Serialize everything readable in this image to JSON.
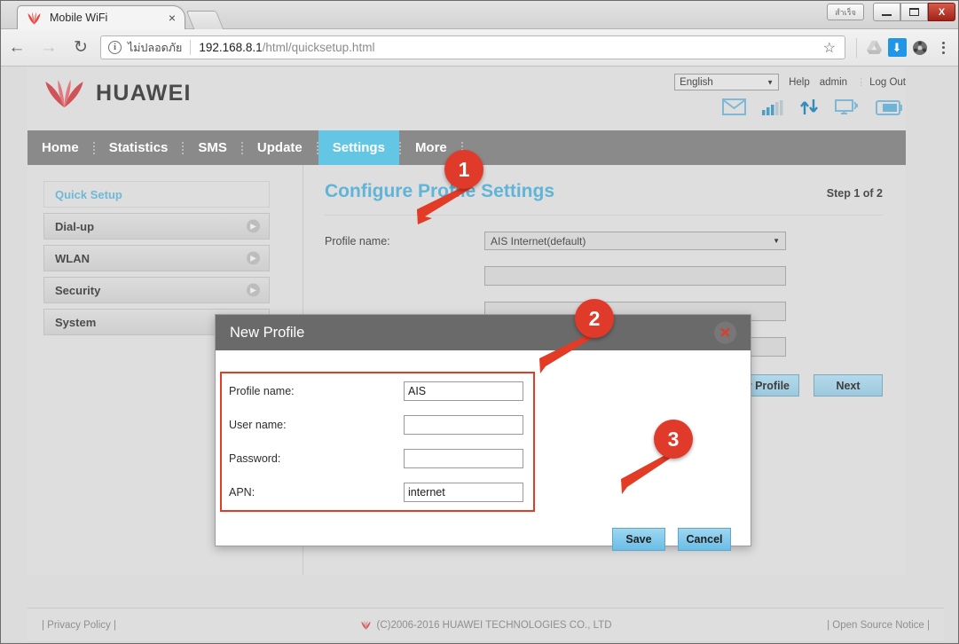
{
  "browser": {
    "tab": {
      "title": "Mobile WiFi",
      "close_label": "×",
      "favicon": "huawei-petal-icon"
    },
    "newtab_label": "",
    "window_controls": {
      "thai_button": "สำเร็จ",
      "minimize": "minimize-icon",
      "maximize": "maximize-icon",
      "close": "X"
    },
    "toolbar": {
      "back": "←",
      "forward": "→",
      "reload": "↻",
      "security_label": "ไม่ปลอดภัย",
      "url_host": "192.168.8.1",
      "url_path": "/html/quicksetup.html",
      "bookmark": "☆",
      "extensions": [
        "drive-icon",
        "download-icon",
        "film-reel-icon"
      ],
      "menu": "kebab-menu-icon"
    }
  },
  "header": {
    "language": {
      "value": "English",
      "caret": "▼"
    },
    "links": [
      "Help",
      "admin",
      "Log Out"
    ],
    "logo_text": "HUAWEI",
    "status_icons": [
      "envelope-icon",
      "signal-bars-icon",
      "data-transfer-icon",
      "wifi-monitor-icon",
      "battery-icon"
    ]
  },
  "nav": {
    "items": [
      {
        "label": "Home",
        "active": false
      },
      {
        "label": "Statistics",
        "active": false
      },
      {
        "label": "SMS",
        "active": false
      },
      {
        "label": "Update",
        "active": false
      },
      {
        "label": "Settings",
        "active": true
      },
      {
        "label": "More",
        "active": false
      }
    ]
  },
  "sidebar": {
    "items": [
      {
        "label": "Quick Setup",
        "current": true,
        "arrow": false
      },
      {
        "label": "Dial-up",
        "current": false,
        "arrow": true
      },
      {
        "label": "WLAN",
        "current": false,
        "arrow": true
      },
      {
        "label": "Security",
        "current": false,
        "arrow": true
      },
      {
        "label": "System",
        "current": false,
        "arrow": true
      }
    ]
  },
  "content": {
    "title": "Configure Profile Settings",
    "step": "Step 1 of 2",
    "fields": [
      {
        "label": "Profile name:",
        "type": "select",
        "value": "AIS Internet(default)"
      },
      {
        "label": "",
        "type": "input",
        "value": ""
      },
      {
        "label": "",
        "type": "input",
        "value": ""
      },
      {
        "label": "",
        "type": "input",
        "value": ""
      }
    ],
    "buttons": [
      {
        "label": "New Profile"
      },
      {
        "label": "Next"
      }
    ]
  },
  "modal": {
    "title": "New Profile",
    "close_label": "✕",
    "fields": [
      {
        "label": "Profile name:",
        "value": "AIS",
        "placeholder": ""
      },
      {
        "label": "User name:",
        "value": "",
        "placeholder": ""
      },
      {
        "label": "Password:",
        "value": "",
        "placeholder": ""
      },
      {
        "label": "APN:",
        "value": "internet",
        "placeholder": ""
      }
    ],
    "save_label": "Save",
    "cancel_label": "Cancel"
  },
  "footer": {
    "privacy": "| Privacy Policy |",
    "copyright": "(C)2006-2016 HUAWEI TECHNOLOGIES CO., LTD",
    "open_source": "| Open Source Notice |"
  },
  "annotations": [
    {
      "number": "1",
      "target": "settings-tab"
    },
    {
      "number": "2",
      "target": "new-profile-form"
    },
    {
      "number": "3",
      "target": "save-button"
    }
  ],
  "colors": {
    "accent": "#63c6e4",
    "annotation_red": "#e03a2a",
    "nav_bg": "#8a8a8a",
    "title_blue": "#5fb4d8"
  }
}
